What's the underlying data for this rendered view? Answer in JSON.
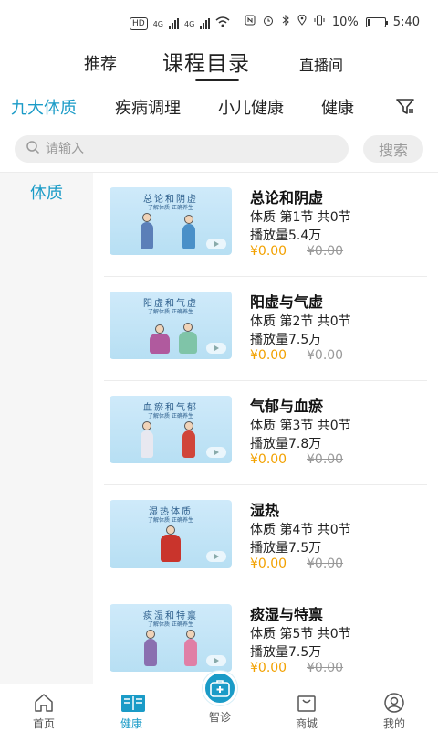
{
  "status_bar": {
    "hd_label": "HD",
    "net1": "4G",
    "net2": "4G",
    "battery_pct_text": "10%",
    "battery_level": 0.1,
    "time": "5:40"
  },
  "top_tabs": [
    {
      "label": "推荐"
    },
    {
      "label": "课程目录",
      "active": true
    },
    {
      "label": "直播间"
    }
  ],
  "category_tabs": [
    {
      "label": "九大体质",
      "active": true
    },
    {
      "label": "疾病调理"
    },
    {
      "label": "小儿健康"
    },
    {
      "label": "健康"
    }
  ],
  "filter_icon": "filter-icon",
  "search": {
    "placeholder": "请输入",
    "button_label": "搜索"
  },
  "sidebar": {
    "items": [
      {
        "label": "体质",
        "active": true
      }
    ]
  },
  "courses": [
    {
      "title": "总论和阴虚",
      "meta": "体质 第1节 共0节",
      "views": "播放量5.4万",
      "price": "¥0.00",
      "original_price": "¥0.00",
      "thumb_title": "总论和阴虚",
      "thumb_sub": "了解体质  正确养生"
    },
    {
      "title": "阳虚与气虚",
      "meta": "体质 第2节 共0节",
      "views": "播放量7.5万",
      "price": "¥0.00",
      "original_price": "¥0.00",
      "thumb_title": "阳虚和气虚",
      "thumb_sub": "了解体质  正确养生"
    },
    {
      "title": "气郁与血瘀",
      "meta": "体质 第3节 共0节",
      "views": "播放量7.8万",
      "price": "¥0.00",
      "original_price": "¥0.00",
      "thumb_title": "血瘀和气郁",
      "thumb_sub": "了解体质  正确养生"
    },
    {
      "title": "湿热",
      "meta": "体质 第4节 共0节",
      "views": "播放量7.5万",
      "price": "¥0.00",
      "original_price": "¥0.00",
      "thumb_title": "湿热体质",
      "thumb_sub": "了解体质  正确养生"
    },
    {
      "title": "痰湿与特禀",
      "meta": "体质 第5节 共0节",
      "views": "播放量7.5万",
      "price": "¥0.00",
      "original_price": "¥0.00",
      "thumb_title": "痰湿和特禀",
      "thumb_sub": "了解体质  正确养生"
    }
  ],
  "bottom_nav": [
    {
      "label": "首页",
      "icon": "home-icon"
    },
    {
      "label": "健康",
      "icon": "book-icon",
      "active": true
    },
    {
      "label": "智诊",
      "icon": "medical-kit-icon"
    },
    {
      "label": "商城",
      "icon": "shopping-bag-icon"
    },
    {
      "label": "我的",
      "icon": "user-icon"
    }
  ],
  "colors": {
    "accent": "#1a9bc7",
    "price": "#f2a100",
    "muted": "#999999"
  }
}
